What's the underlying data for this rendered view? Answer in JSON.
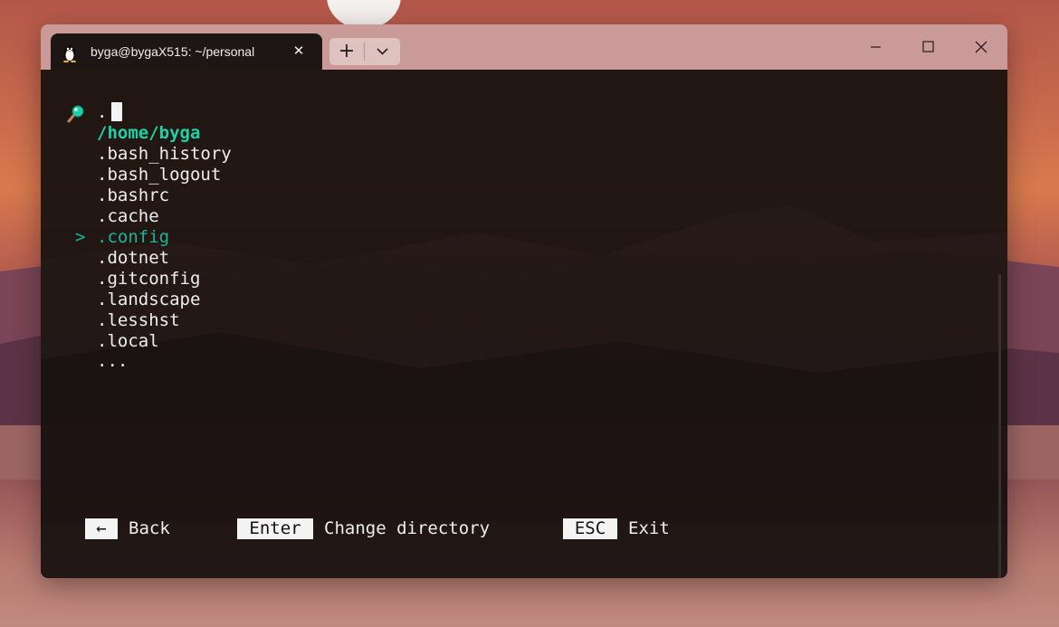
{
  "window": {
    "tab_title": "byga@bygaX515: ~/personal",
    "tab_icon": "linux-penguin-icon",
    "new_tab_label": "+",
    "close_tab_glyph": "✕"
  },
  "terminal": {
    "prompt_text": ".",
    "current_dir": "/home/byga",
    "entries": [
      ".bash_history",
      ".bash_logout",
      ".bashrc",
      ".cache",
      ".config",
      ".dotnet",
      ".gitconfig",
      ".landscape",
      ".lesshst",
      ".local"
    ],
    "selected_entry": ".config",
    "selection_marker": ">",
    "more_indicator": "..."
  },
  "footer": {
    "back_key": "←",
    "back_label": "Back",
    "enter_key": "Enter",
    "enter_label": "Change directory",
    "esc_key": "ESC",
    "esc_label": "Exit"
  },
  "colors": {
    "accent": "#1bd1a5",
    "terminal_bg": "#16100f",
    "titlebar": "#c99a97"
  }
}
